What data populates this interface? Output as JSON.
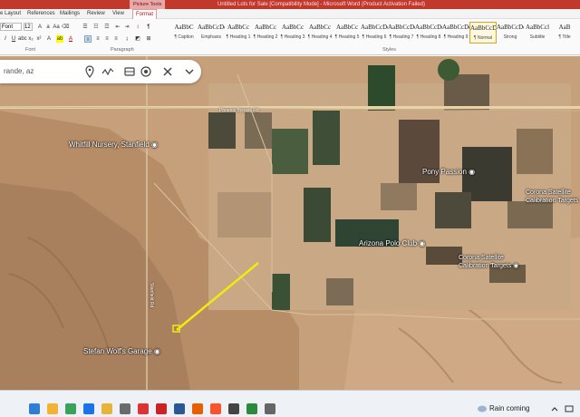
{
  "word": {
    "window_title": "Untitled Lots for Sale [Compatibility Mode] - Microsoft Word (Product Activation Failed)",
    "context_tab": "Picture Tools",
    "tabs": [
      "e Layout",
      "References",
      "Mailings",
      "Review",
      "View",
      "Format"
    ],
    "font_name": "Font",
    "font_size": "12",
    "group_labels": {
      "font": "Font",
      "paragraph": "Paragraph",
      "styles": "Styles"
    },
    "styles": [
      {
        "sample": "AaBbC",
        "name": "¶ Caption"
      },
      {
        "sample": "AaBbCcDc",
        "name": "Emphasis"
      },
      {
        "sample": "AaBbCc",
        "name": "¶ Heading 1"
      },
      {
        "sample": "AaBbCc",
        "name": "¶ Heading 2"
      },
      {
        "sample": "AaBbCc",
        "name": "¶ Heading 3"
      },
      {
        "sample": "AaBbCc",
        "name": "¶ Heading 4"
      },
      {
        "sample": "AaBbCc",
        "name": "¶ Heading 5"
      },
      {
        "sample": "AaBbCcDc",
        "name": "¶ Heading 6"
      },
      {
        "sample": "AaBbCcDc",
        "name": "¶ Heading 7"
      },
      {
        "sample": "AaBbCcDc",
        "name": "¶ Heading 8"
      },
      {
        "sample": "AaBbCcDc",
        "name": "¶ Heading 9"
      },
      {
        "sample": "AaBbCcDc",
        "name": "¶ Normal",
        "active": true
      },
      {
        "sample": "AaBbCcDd",
        "name": "Strong"
      },
      {
        "sample": "AaBbCcl",
        "name": "Subtitle"
      },
      {
        "sample": "AaB",
        "name": "¶ Title"
      }
    ]
  },
  "maps": {
    "search_query": "rande, az",
    "icons": [
      "location-pin-icon",
      "trend-icon",
      "bus-icon",
      "hotel-icon",
      "pills-icon",
      "chevron-down-icon"
    ],
    "road_label": "Phoenix Bypass Rd",
    "road_label_2": "Stanfield Rd",
    "pois": [
      {
        "label": "Whitfill Nursery, Stanfield"
      },
      {
        "label": "Pony Passion"
      },
      {
        "label": "Arizona Polo Club"
      },
      {
        "label": "Corona Satellite\nCalibration Targets"
      },
      {
        "label": "Corona Satellite\nCalibration Targets"
      },
      {
        "label": "Stefan Wolf's Garage"
      }
    ]
  },
  "taskbar": {
    "weather_text": "Rain coming",
    "icons": [
      "copilot-icon",
      "search-icon",
      "chrome-icon",
      "edge-icon",
      "file-explorer-icon",
      "app-icon",
      "calendar-icon",
      "pdf-icon",
      "word-icon",
      "firefox-icon",
      "brave-icon",
      "calculator-icon",
      "shield-icon",
      "app-icon-2"
    ]
  },
  "colors": {
    "title_bar": "#c0392b",
    "annotation_arrow": "#f2ea0c",
    "map_desert": "#c49a73"
  }
}
